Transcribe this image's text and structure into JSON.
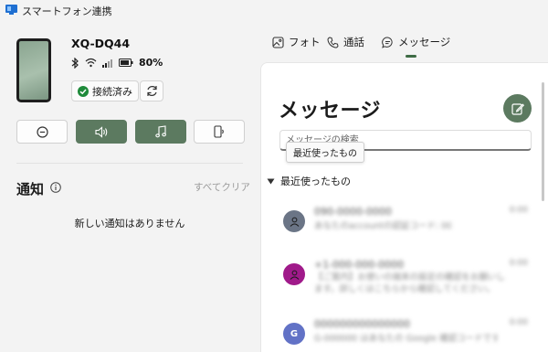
{
  "window": {
    "title": "スマートフォン連携"
  },
  "device": {
    "name": "XQ-DQ44",
    "battery": "80%",
    "connected_label": "接続済み"
  },
  "quick_actions": [
    {
      "icon": "do-not-disturb-icon",
      "active": false
    },
    {
      "icon": "volume-icon",
      "active": true
    },
    {
      "icon": "music-icon",
      "active": true
    },
    {
      "icon": "phone-audio-icon",
      "active": false
    }
  ],
  "notifications": {
    "title": "通知",
    "clear_all": "すべてクリア",
    "empty": "新しい通知はありません"
  },
  "tabs": [
    {
      "label": "フォト",
      "icon": "photo-icon"
    },
    {
      "label": "通話",
      "icon": "phone-call-icon"
    },
    {
      "label": "メッセージ",
      "icon": "message-icon",
      "selected": true
    }
  ],
  "messages": {
    "title": "メッセージ",
    "search_placeholder": "メッセージの検索",
    "tooltip": "最近使ったもの",
    "recent_label": "最近使ったもの",
    "conversations": [
      {
        "avatar_letter": "",
        "avatar_color": "#6b7586",
        "name": "090-0000-0000",
        "time": "0:00",
        "preview": "あなたのaccountの認証コード: 000000です"
      },
      {
        "avatar_letter": "",
        "avatar_color": "#a01a8a",
        "name": "+1-000-000-0000",
        "time": "0:00",
        "preview": "【ご案内】お使いの端末の設定の確認をお願いします。詳しくはこちらから確認してください。"
      },
      {
        "avatar_letter": "G",
        "avatar_color": "#6272c6",
        "name": "000000000000000",
        "time": "0:00",
        "preview": "G-000000 はあなたの Google 確認コードです"
      }
    ]
  },
  "colors": {
    "accent": "#5c7a60",
    "panel_bg": "#ffffff",
    "window_bg": "#f3f3f3"
  }
}
